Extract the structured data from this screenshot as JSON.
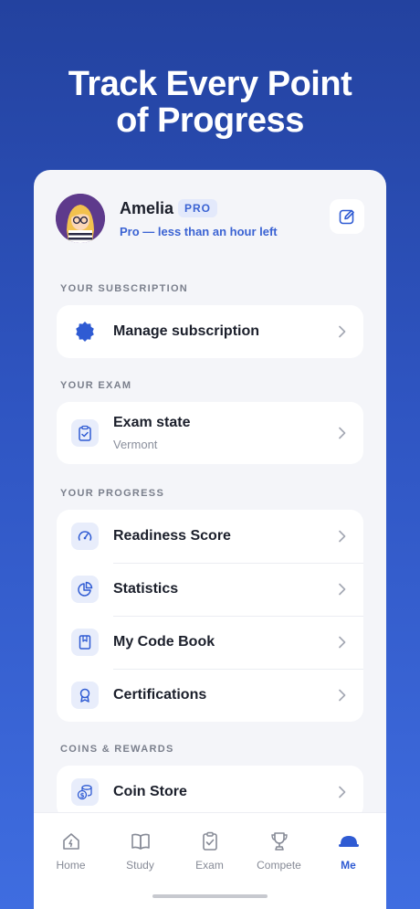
{
  "headline": {
    "line1": "Track Every Point",
    "line2": "of Progress"
  },
  "profile": {
    "name": "Amelia",
    "badge": "PRO",
    "status": "Pro — less than an hour left"
  },
  "sections": {
    "subscription": {
      "title": "YOUR SUBSCRIPTION",
      "items": [
        {
          "label": "Manage subscription",
          "icon": "badge-icon"
        }
      ]
    },
    "exam": {
      "title": "YOUR EXAM",
      "items": [
        {
          "label": "Exam state",
          "sub": "Vermont",
          "icon": "clipboard-check-icon"
        }
      ]
    },
    "progress": {
      "title": "YOUR PROGRESS",
      "items": [
        {
          "label": "Readiness Score",
          "icon": "gauge-icon"
        },
        {
          "label": "Statistics",
          "icon": "pie-chart-icon"
        },
        {
          "label": "My Code Book",
          "icon": "book-icon"
        },
        {
          "label": "Certifications",
          "icon": "award-icon"
        }
      ]
    },
    "rewards": {
      "title": "COINS & REWARDS",
      "items": [
        {
          "label": "Coin Store",
          "icon": "coins-icon"
        }
      ]
    }
  },
  "tabbar": {
    "items": [
      {
        "label": "Home",
        "icon": "home-icon"
      },
      {
        "label": "Study",
        "icon": "open-book-icon"
      },
      {
        "label": "Exam",
        "icon": "clipboard-icon"
      },
      {
        "label": "Compete",
        "icon": "trophy-icon"
      },
      {
        "label": "Me",
        "icon": "hard-hat-icon",
        "active": true
      }
    ]
  },
  "colors": {
    "accent": "#2f5bd3",
    "background_top": "#23429f",
    "background_bottom": "#3f6de0"
  }
}
